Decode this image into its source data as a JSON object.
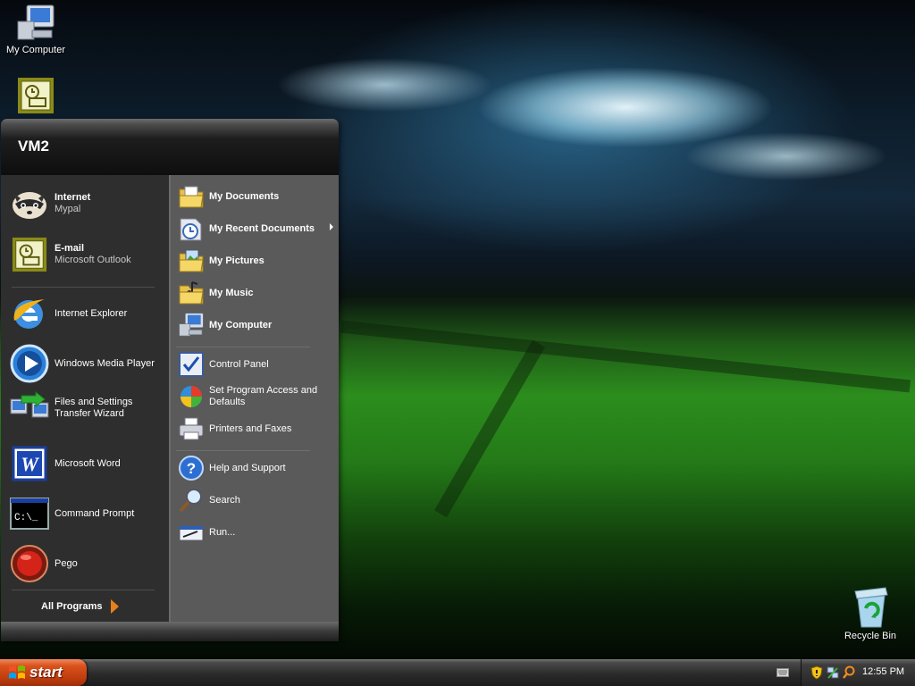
{
  "desktop": {
    "icons": [
      {
        "label": "My Computer",
        "icon": "my-computer-icon"
      },
      {
        "label": "",
        "icon": "outlook-icon"
      },
      {
        "label": "Recycle Bin",
        "icon": "recycle-bin-icon"
      }
    ]
  },
  "start_menu": {
    "user_name": "VM2",
    "pinned": [
      {
        "title": "Internet",
        "subtitle": "Mypal",
        "icon": "mypal-raccoon-icon"
      },
      {
        "title": "E-mail",
        "subtitle": "Microsoft Outlook",
        "icon": "outlook-icon"
      }
    ],
    "recent": [
      {
        "line1": "Internet Explorer",
        "line2": "",
        "icon": "internet-explorer-icon"
      },
      {
        "line1": "Windows Media Player",
        "line2": "",
        "icon": "media-player-icon"
      },
      {
        "line1": "Files and Settings",
        "line2": "Transfer Wizard",
        "icon": "transfer-wizard-icon"
      },
      {
        "line1": "Microsoft Word",
        "line2": "",
        "icon": "word-icon"
      },
      {
        "line1": "Command Prompt",
        "line2": "",
        "icon": "command-prompt-icon"
      },
      {
        "line1": "Pego",
        "line2": "",
        "icon": "pego-icon"
      }
    ],
    "all_programs": "All Programs",
    "places": [
      {
        "label": "My Documents",
        "icon": "my-documents-icon"
      },
      {
        "label": "My Recent Documents",
        "icon": "recent-documents-icon"
      },
      {
        "label": "My Pictures",
        "icon": "my-pictures-icon"
      },
      {
        "label": "My Music",
        "icon": "my-music-icon"
      },
      {
        "label": "My Computer",
        "icon": "my-computer-icon"
      }
    ],
    "settings": [
      {
        "line1": "Control Panel",
        "line2": "",
        "icon": "control-panel-icon"
      },
      {
        "line1": "Set Program Access and",
        "line2": "Defaults",
        "icon": "program-access-icon"
      },
      {
        "line1": "Printers and Faxes",
        "line2": "",
        "icon": "printer-icon"
      }
    ],
    "tools": [
      {
        "label": "Help and Support",
        "icon": "help-icon"
      },
      {
        "label": "Search",
        "icon": "search-icon"
      },
      {
        "label": "Run...",
        "icon": "run-icon"
      }
    ]
  },
  "taskbar": {
    "start_label": "start",
    "clock": "12:55 PM"
  }
}
